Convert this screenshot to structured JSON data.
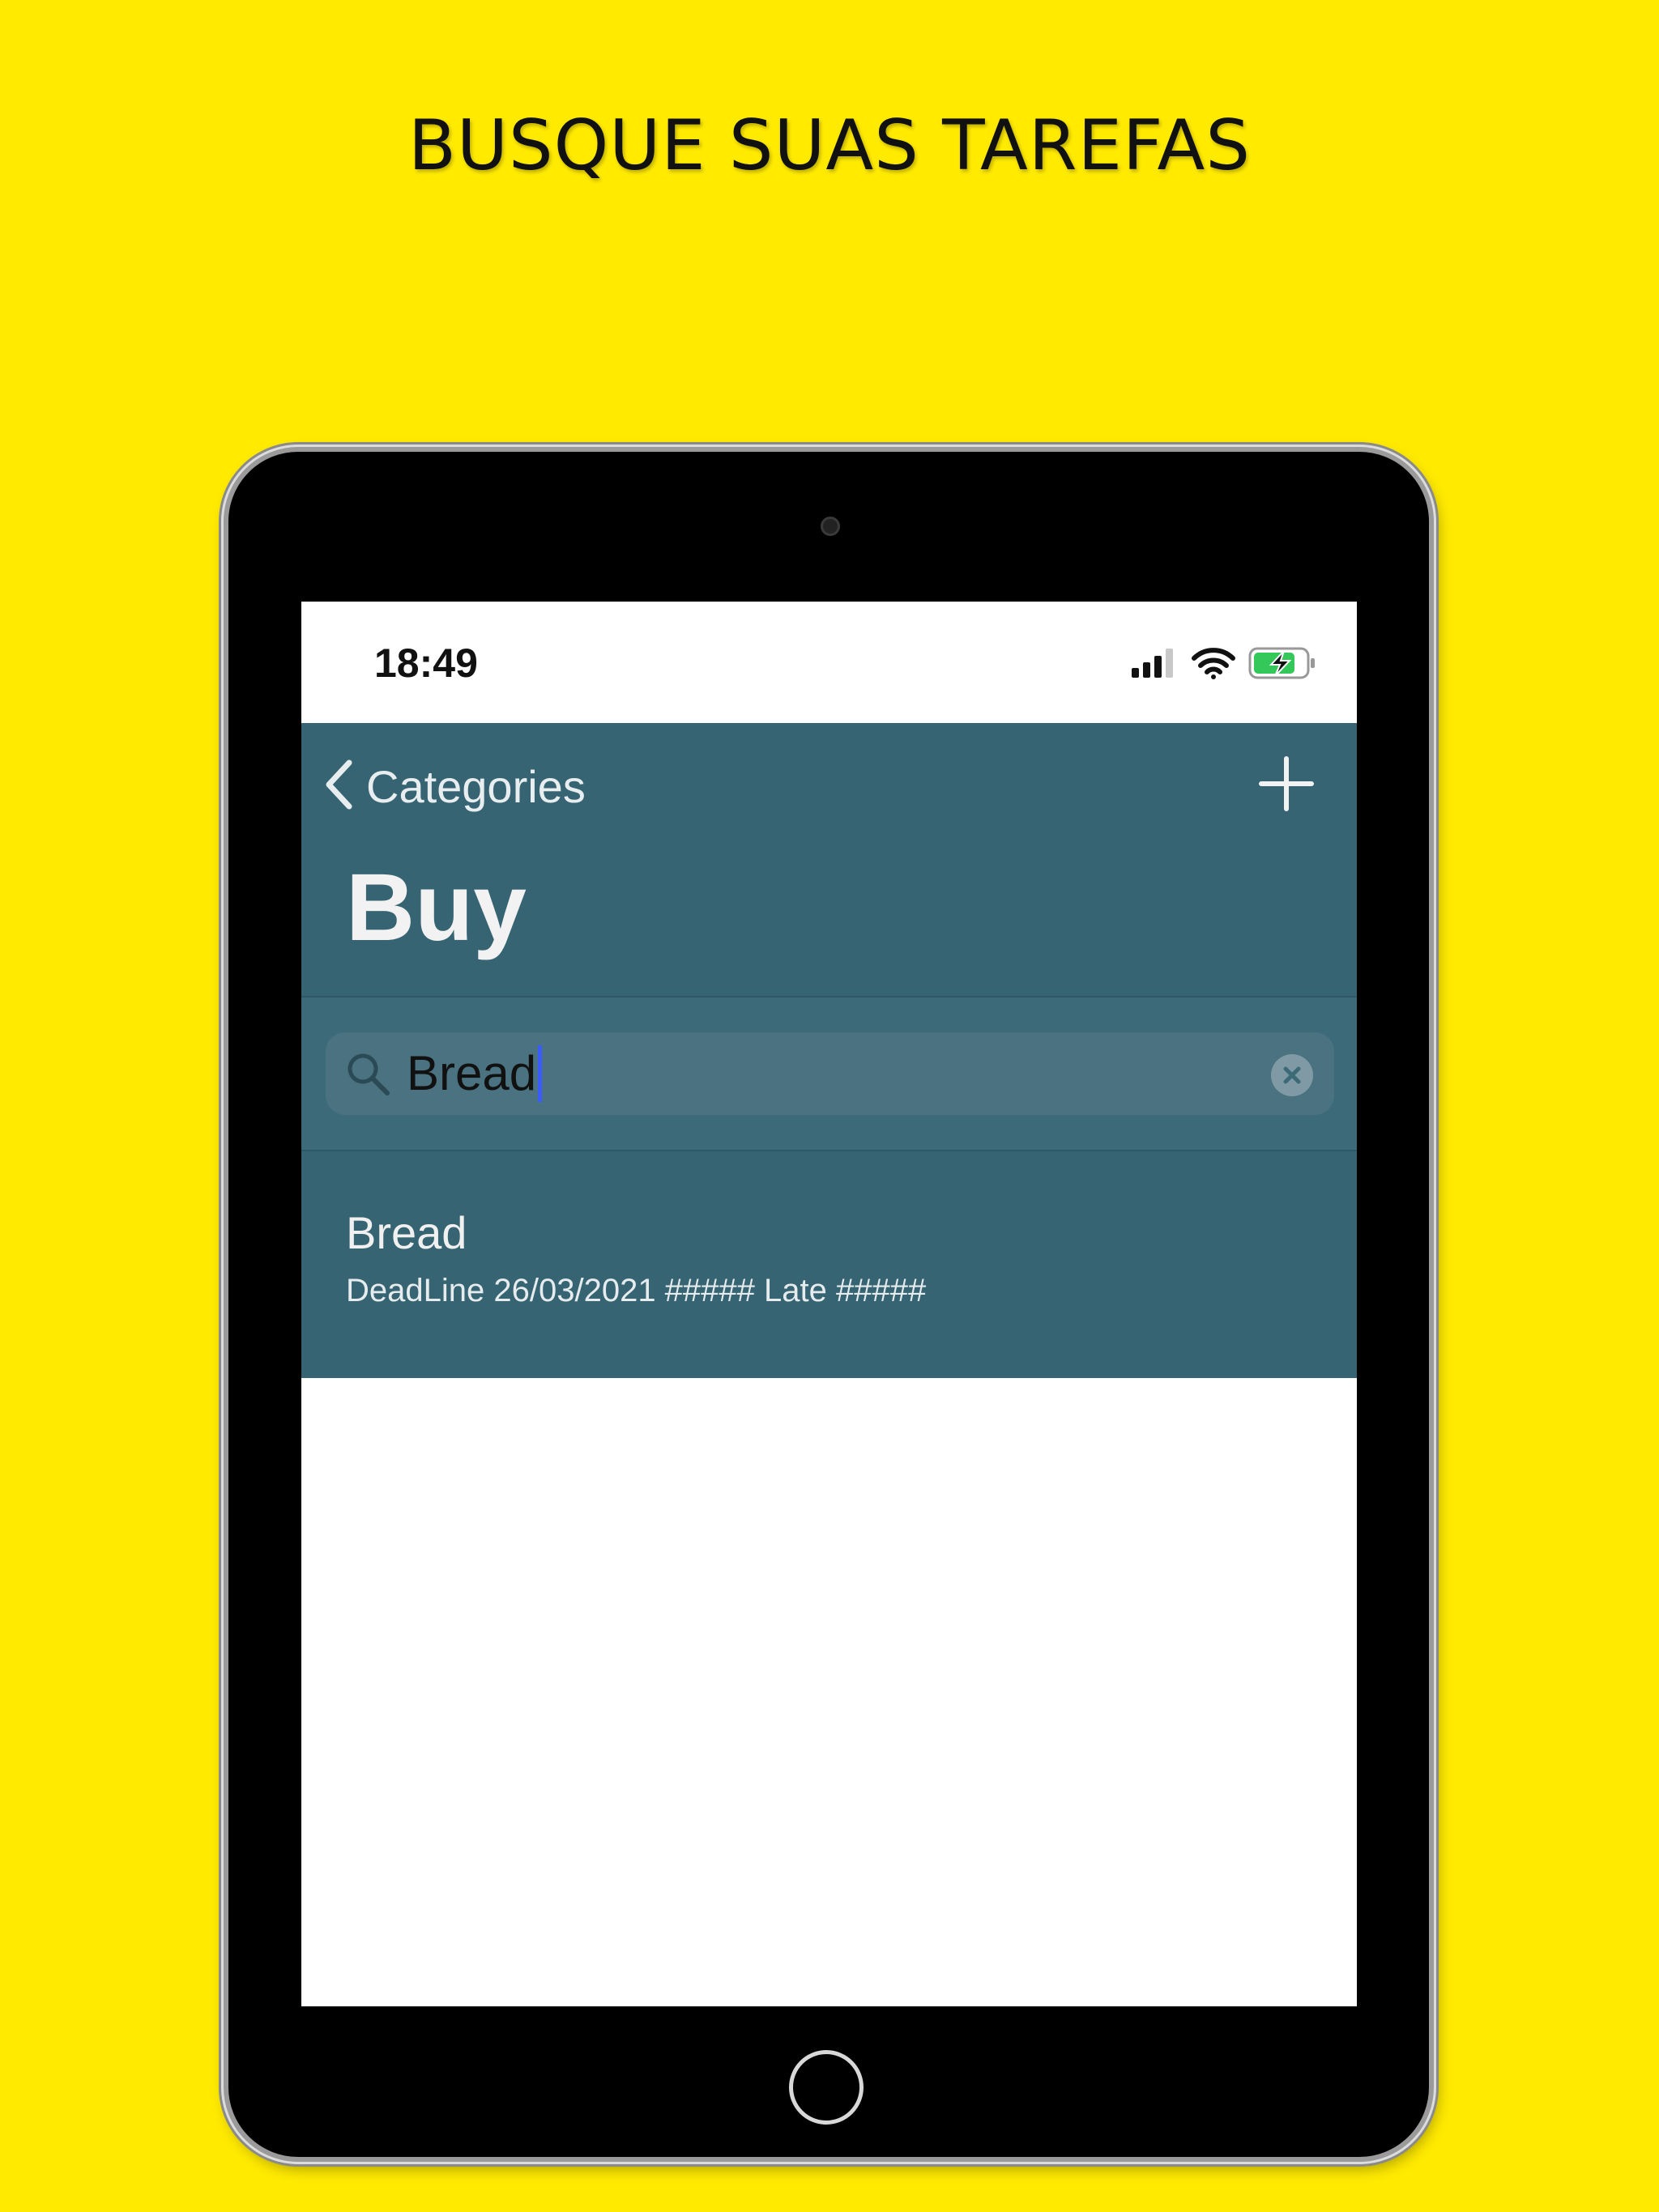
{
  "promo": {
    "title": "BUSQUE SUAS TAREFAS"
  },
  "status_bar": {
    "time": "18:49",
    "icons": [
      "signal-icon",
      "wifi-icon",
      "battery-charging-icon"
    ]
  },
  "nav": {
    "back_label": "Categories",
    "back_icon": "chevron-left-icon",
    "add_icon": "plus-icon",
    "title": "Buy",
    "background": "#376473"
  },
  "search": {
    "value": "Bread",
    "search_icon": "search-icon",
    "clear_icon": "clear-icon"
  },
  "results": [
    {
      "title": "Bread",
      "subtitle": "DeadLine 26/03/2021 ##### Late #####"
    }
  ],
  "colors": {
    "promo_background": "#FFEA00",
    "accent": "#376473"
  }
}
